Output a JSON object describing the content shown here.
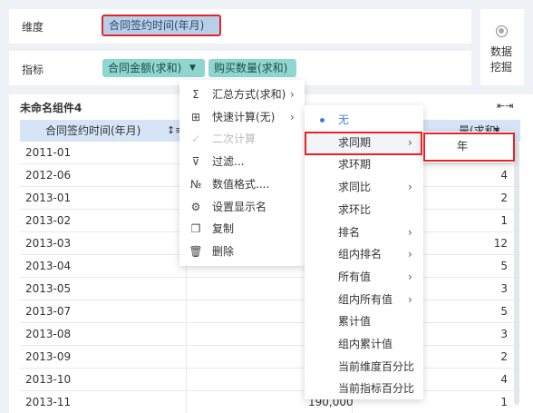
{
  "dimension_row": {
    "label": "维度",
    "field": "合同签约时间(年月)"
  },
  "indicator_row": {
    "label": "指标",
    "metric1": "合同金额(求和)",
    "metric2": "购买数量(求和)"
  },
  "side_button": {
    "line1": "数据",
    "line2": "挖掘"
  },
  "component": {
    "title": "未命名组件4"
  },
  "table": {
    "headers": [
      "合同签约时间(年月)",
      "量(求和)"
    ],
    "rows": [
      {
        "date": "2011-01",
        "mid": "",
        "count": ""
      },
      {
        "date": "2012-06",
        "mid": "",
        "count": "4"
      },
      {
        "date": "2013-01",
        "mid": "",
        "count": "2"
      },
      {
        "date": "2013-02",
        "mid": "",
        "count": "1"
      },
      {
        "date": "2013-03",
        "mid": "",
        "count": "12"
      },
      {
        "date": "2013-04",
        "mid": "",
        "count": "5"
      },
      {
        "date": "2013-05",
        "mid": "",
        "count": "3"
      },
      {
        "date": "2013-07",
        "mid": "",
        "count": "5"
      },
      {
        "date": "2013-08",
        "mid": "",
        "count": "3"
      },
      {
        "date": "2013-09",
        "mid": "",
        "count": "2"
      },
      {
        "date": "2013-10",
        "mid": "",
        "count": "4"
      },
      {
        "date": "2013-11",
        "mid": "190,000",
        "count": "1"
      }
    ]
  },
  "context_menu": {
    "items": [
      {
        "label": "汇总方式(求和)",
        "icon": "sigma-icon"
      },
      {
        "label": "快速计算(无)",
        "icon": "calc-icon"
      },
      {
        "label": "二次计算",
        "icon": "check-icon"
      },
      {
        "label": "过滤...",
        "icon": "filter-icon"
      },
      {
        "label": "数值格式....",
        "icon": "number-format-icon"
      },
      {
        "label": "设置显示名",
        "icon": "gear-icon"
      },
      {
        "label": "复制",
        "icon": "copy-icon"
      },
      {
        "label": "删除",
        "icon": "trash-icon"
      }
    ]
  },
  "quick_calc_menu": {
    "items": [
      "无",
      "求同期",
      "求环期",
      "求同比",
      "求环比",
      "排名",
      "组内排名",
      "所有值",
      "组内所有值",
      "累计值",
      "组内累计值",
      "当前维度百分比",
      "当前指标百分比"
    ]
  },
  "year_menu": {
    "label": "年"
  },
  "colors": {
    "highlight_red": "#e5242a",
    "dimension_blue": "#b8cfe8",
    "metric_teal": "#8fd6cf",
    "header_blue": "#d5e4f6",
    "accent": "#3d7fe0"
  }
}
